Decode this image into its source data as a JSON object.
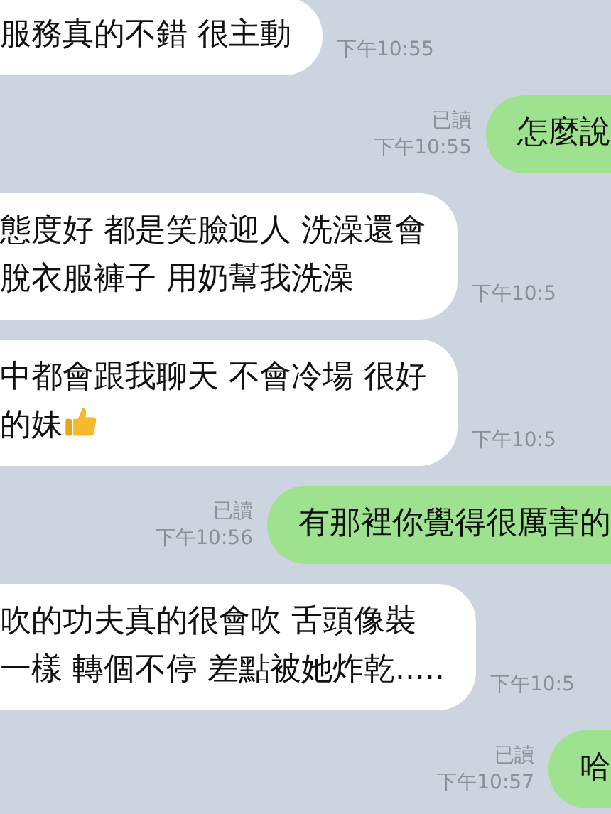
{
  "messages": [
    {
      "kind": "incoming",
      "lines": [
        "服務真的不錯 很主動"
      ],
      "time": "下午10:55"
    },
    {
      "kind": "outgoing",
      "lines": [
        "怎麼說"
      ],
      "read": "已讀",
      "time": "下午10:55"
    },
    {
      "kind": "incoming",
      "lines": [
        "態度好 都是笑臉迎人 洗澡還會",
        "脫衣服褲子 用奶幫我洗澡"
      ],
      "time": "下午10:5"
    },
    {
      "kind": "incoming",
      "lines": [
        "中都會跟我聊天 不會冷場 很好",
        "的妹"
      ],
      "thumbs_up": true,
      "time": "下午10:5"
    },
    {
      "kind": "outgoing",
      "lines": [
        "有那裡你覺得很厲害的"
      ],
      "read": "已讀",
      "time": "下午10:56"
    },
    {
      "kind": "incoming",
      "lines": [
        "吹的功夫真的很會吹 舌頭像裝",
        "一樣 轉個不停 差點被她炸乾....."
      ],
      "time": "下午10:5"
    },
    {
      "kind": "outgoing",
      "lines": [
        "哈"
      ],
      "read": "已讀",
      "time": "下午10:57"
    }
  ]
}
